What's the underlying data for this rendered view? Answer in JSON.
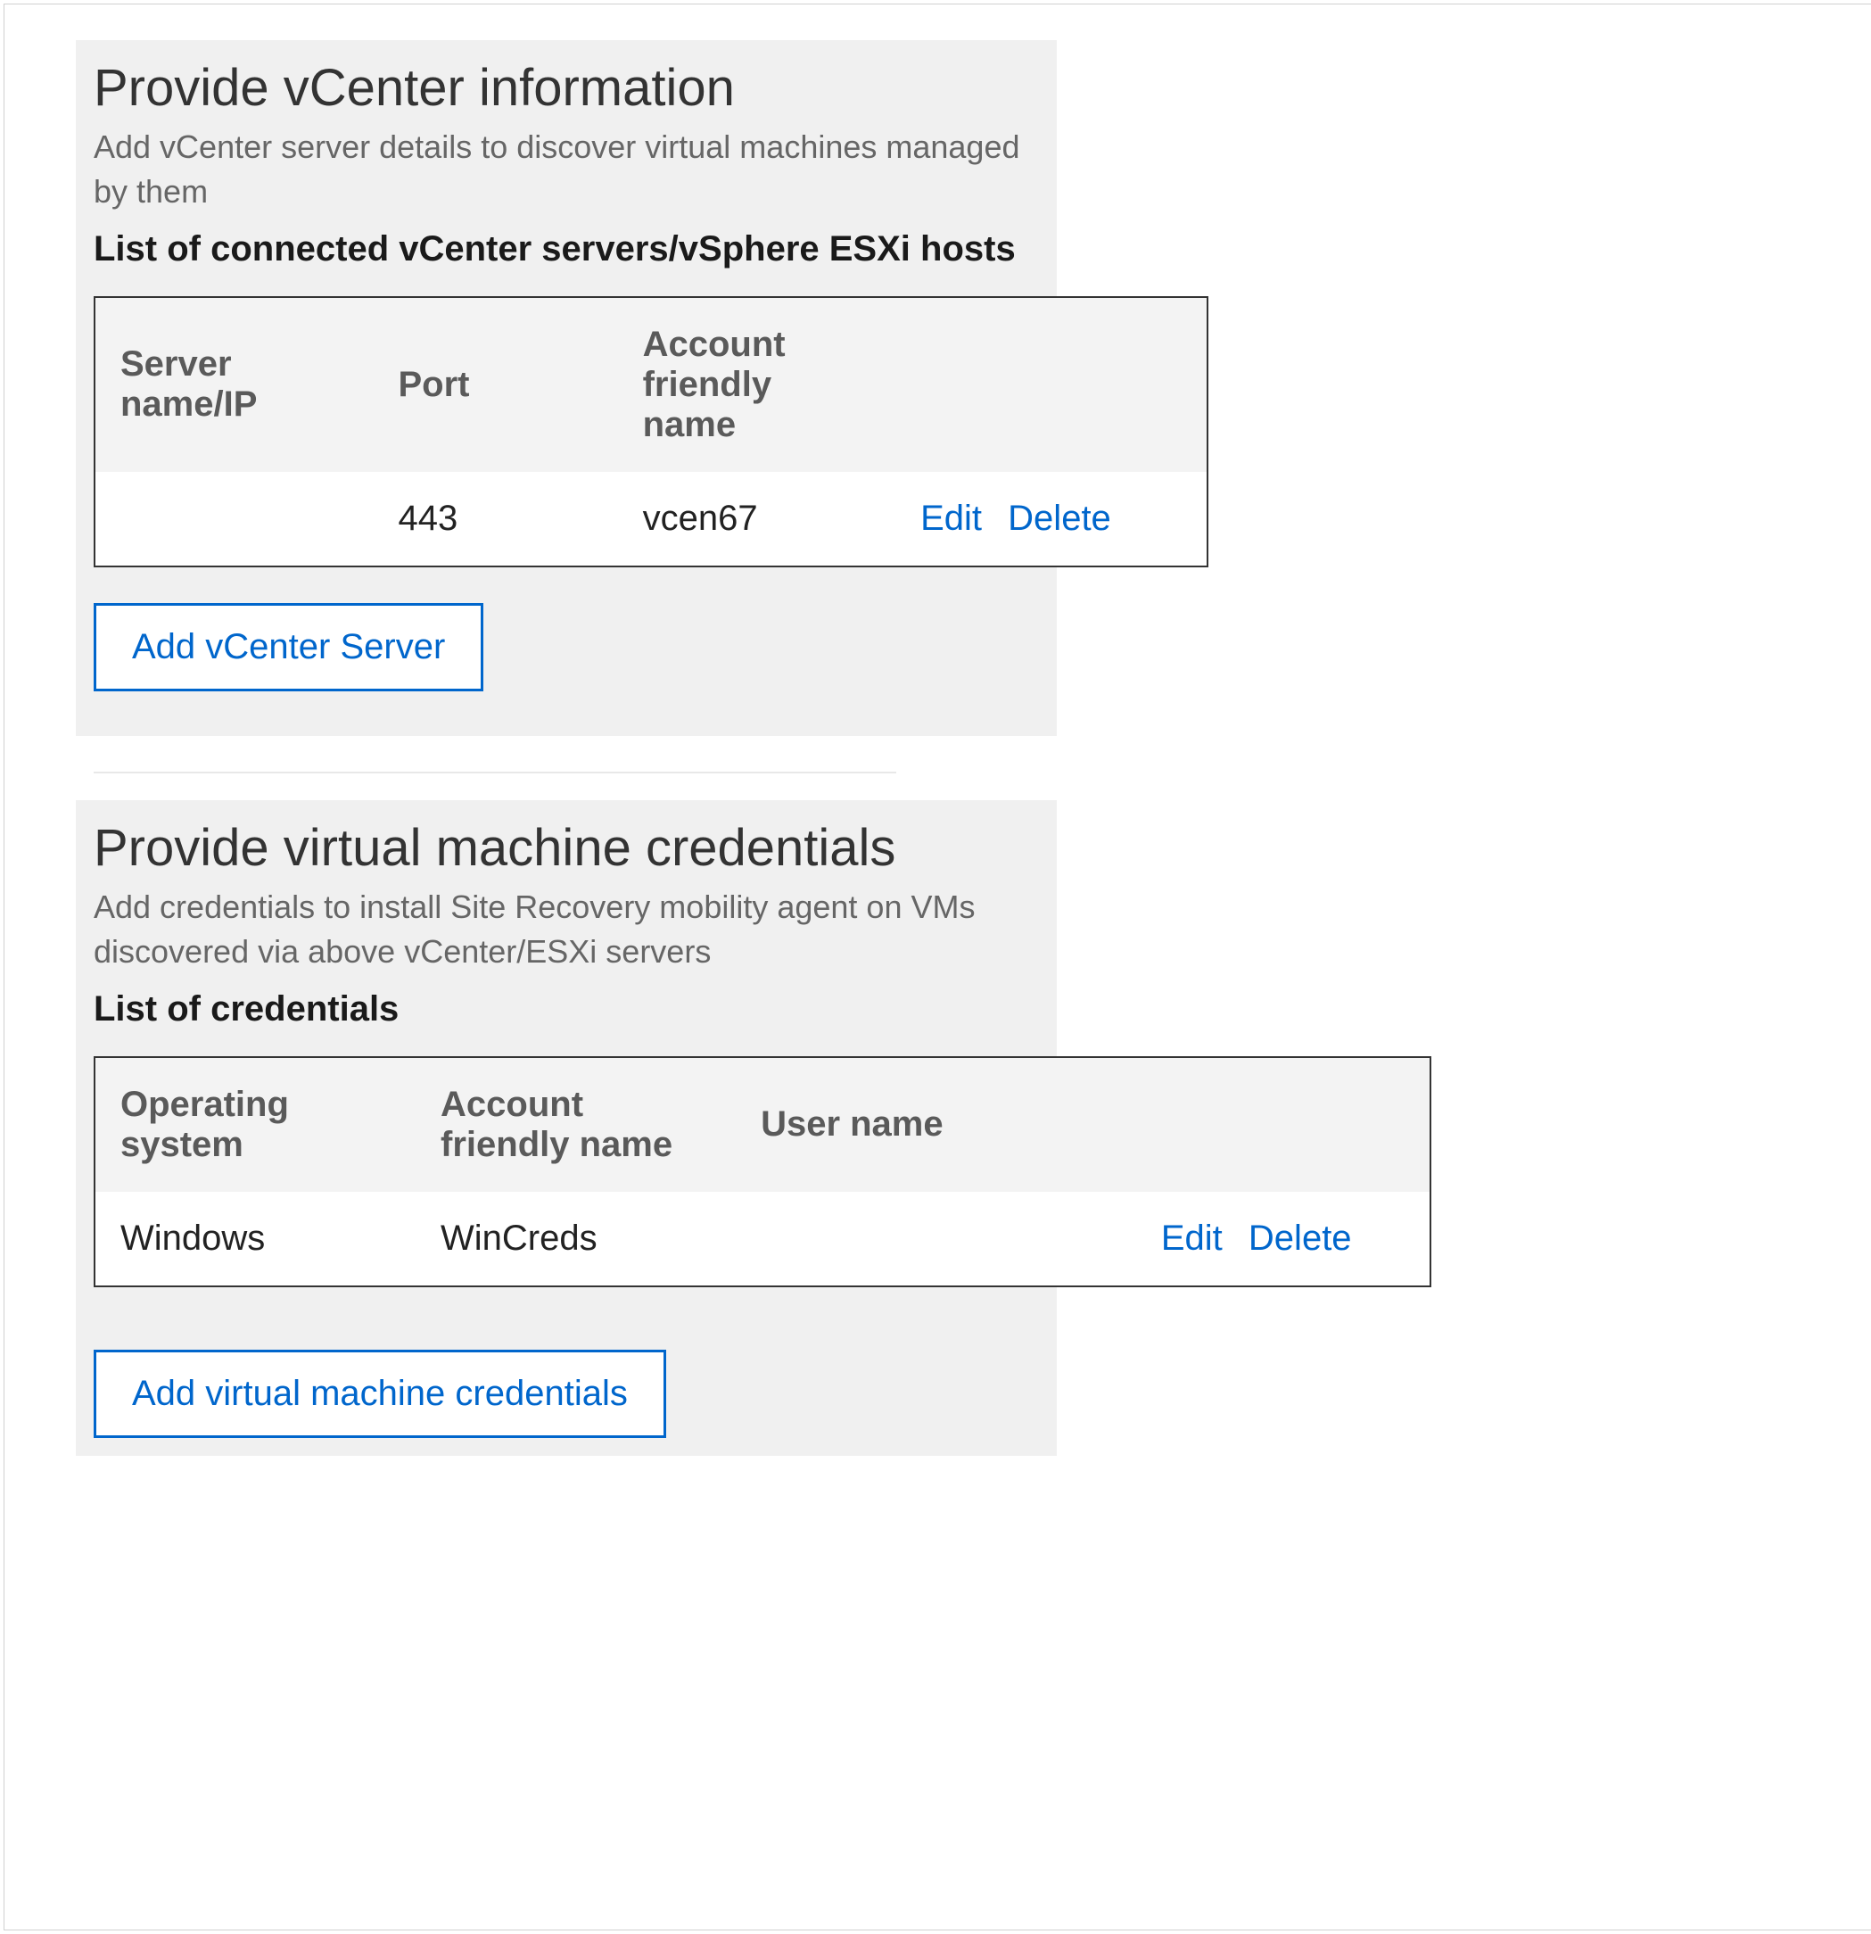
{
  "vcenter_section": {
    "title": "Provide vCenter information",
    "subtitle": "Add vCenter server details to discover virtual machines managed by them",
    "list_label": "List of connected vCenter servers/vSphere ESXi hosts",
    "table": {
      "headers": {
        "server": "Server name/IP",
        "port": "Port",
        "account": "Account friendly name"
      },
      "row": {
        "server": "",
        "port": "443",
        "account": "vcen67",
        "edit": "Edit",
        "delete": "Delete"
      }
    },
    "add_button": "Add vCenter Server"
  },
  "vm_credentials_section": {
    "title": "Provide virtual machine credentials",
    "subtitle": "Add credentials to install Site Recovery mobility agent on VMs discovered via above vCenter/ESXi servers",
    "list_label": "List of credentials",
    "table": {
      "headers": {
        "os": "Operating system",
        "account": "Account friendly name",
        "user": "User name"
      },
      "row": {
        "os": "Windows",
        "account": "WinCreds",
        "user": "",
        "edit": "Edit",
        "delete": "Delete"
      }
    },
    "add_button": "Add virtual machine credentials"
  }
}
